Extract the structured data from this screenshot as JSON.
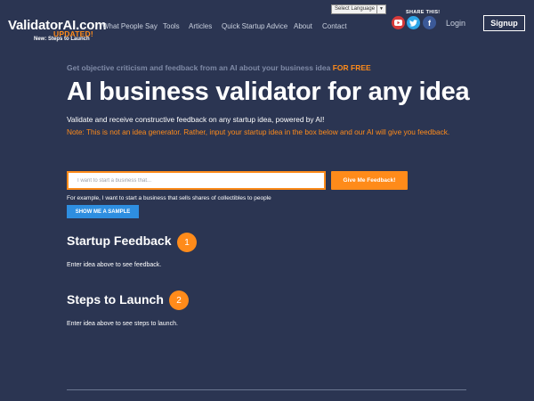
{
  "header": {
    "logo": "ValidatorAI.com",
    "logo_updated": "UPDATED!",
    "logo_tagline": "New: Steps to Launch",
    "nav": [
      {
        "label": "What People Say"
      },
      {
        "label": "Tools"
      },
      {
        "label": "Articles"
      },
      {
        "label": "Quick Startup Advice"
      },
      {
        "label": "About"
      },
      {
        "label": "Contact"
      }
    ],
    "language_select": "Select Language",
    "share_label": "SHARE THIS!",
    "social_icons": [
      "youtube-icon",
      "twitter-icon",
      "facebook-icon"
    ],
    "login_label": "Login",
    "signup_label": "Signup"
  },
  "hero": {
    "kicker": "Get objective criticism and feedback from an AI about your business idea",
    "kicker_highlight": "FOR FREE",
    "title": "AI business validator for any idea",
    "subtitle": "Validate and receive constructive feedback on any startup idea, powered by AI!",
    "note": "Note: This is not an idea generator. Rather, input your startup idea in the box below and our AI will give you feedback."
  },
  "form": {
    "input_placeholder": "I want to start a business that...",
    "input_value": "",
    "submit_label": "Give Me Feedback!",
    "example_text": "For example, I want to start a business that sells shares of collectibles to people",
    "sample_label": "SHOW ME A SAMPLE"
  },
  "sections": [
    {
      "title": "Startup Feedback",
      "step": "1",
      "text": "Enter idea above to see feedback."
    },
    {
      "title": "Steps to Launch",
      "step": "2",
      "text": "Enter idea above to see steps to launch."
    }
  ],
  "colors": {
    "background": "#2b3552",
    "accent": "#ff8b1a",
    "button_blue": "#2e8ee0"
  }
}
